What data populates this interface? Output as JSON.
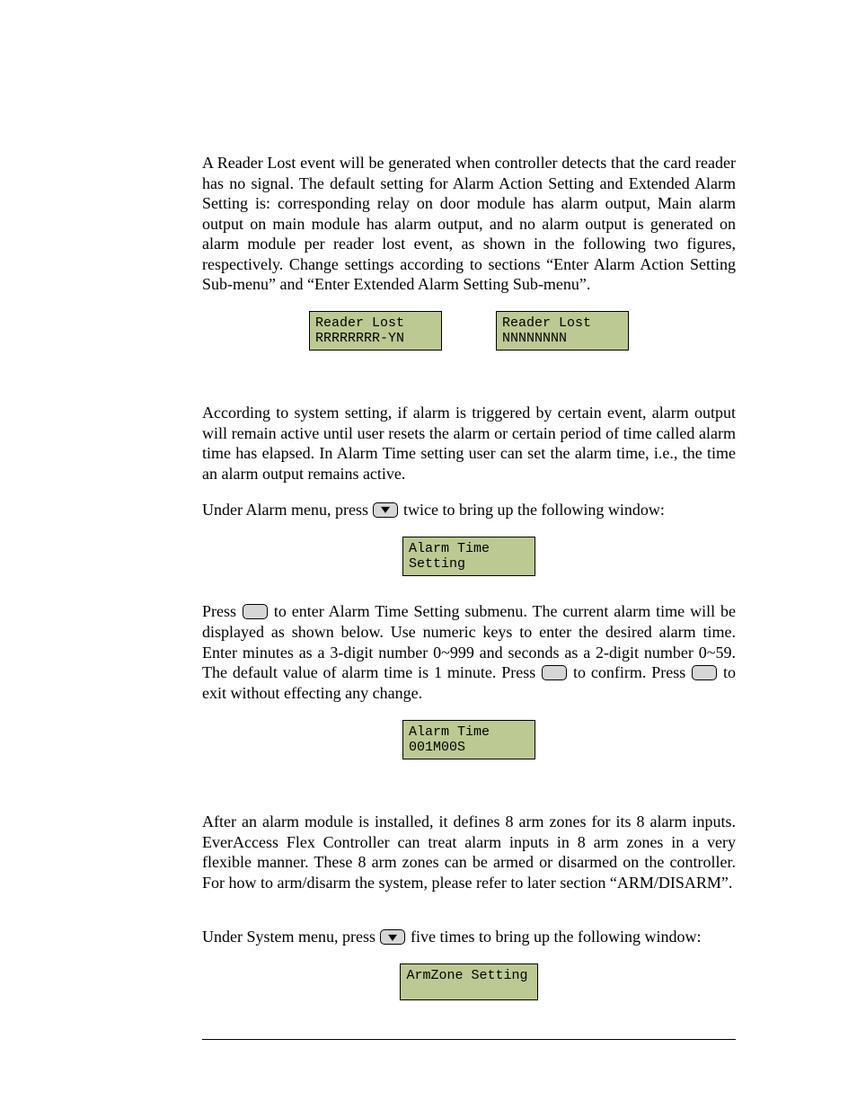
{
  "p1": "A Reader Lost event will be generated when controller detects that the card reader has no signal. The default setting for Alarm Action Setting and Extended Alarm Setting is: corresponding relay on door module has alarm output, Main alarm output on main module has alarm output, and no alarm output is generated on alarm module per reader lost event, as shown in the following two figures, respectively. Change settings according to sections “Enter Alarm Action Setting Sub-menu” and “Enter Extended Alarm Setting Sub-menu”.",
  "lcd1_line1": "Reader Lost",
  "lcd1_line2": "RRRRRRRR-YN",
  "lcd2_line1": "Reader Lost",
  "lcd2_line2": "NNNNNNNN",
  "p2": "According to system setting, if alarm is triggered by certain event, alarm output will remain active until user resets the alarm or certain period of time called alarm time has elapsed. In Alarm Time setting user can set the alarm time, i.e., the time an alarm output remains active.",
  "p3_a": "Under Alarm menu, press ",
  "p3_b": " twice to bring up the following window:",
  "lcd3_line1": "Alarm Time",
  "lcd3_line2": "Setting",
  "p4_a": "Press ",
  "p4_b": " to enter Alarm Time Setting submenu. The current alarm time will be displayed as shown below. Use numeric keys to enter the desired alarm time. Enter minutes as a 3-digit number 0~999 and seconds as a 2-digit number 0~59. The default value of alarm time is 1 minute. Press ",
  "p4_c": " to confirm. Press ",
  "p4_d": " to exit without effecting any change.",
  "lcd4_line1": "Alarm Time",
  "lcd4_line2": "001M00S",
  "p5": "After an alarm module is installed, it defines 8 arm zones for its 8 alarm inputs. EverAccess Flex Controller can treat alarm inputs in 8 arm zones in a very flexible manner. These 8 arm zones can be armed or disarmed on the controller. For how to arm/disarm the system, please refer to later section “ARM/DISARM”.",
  "p6_a": "Under System menu, press ",
  "p6_b": " five times to bring up the following window:",
  "lcd5_line1": "ArmZone Setting"
}
